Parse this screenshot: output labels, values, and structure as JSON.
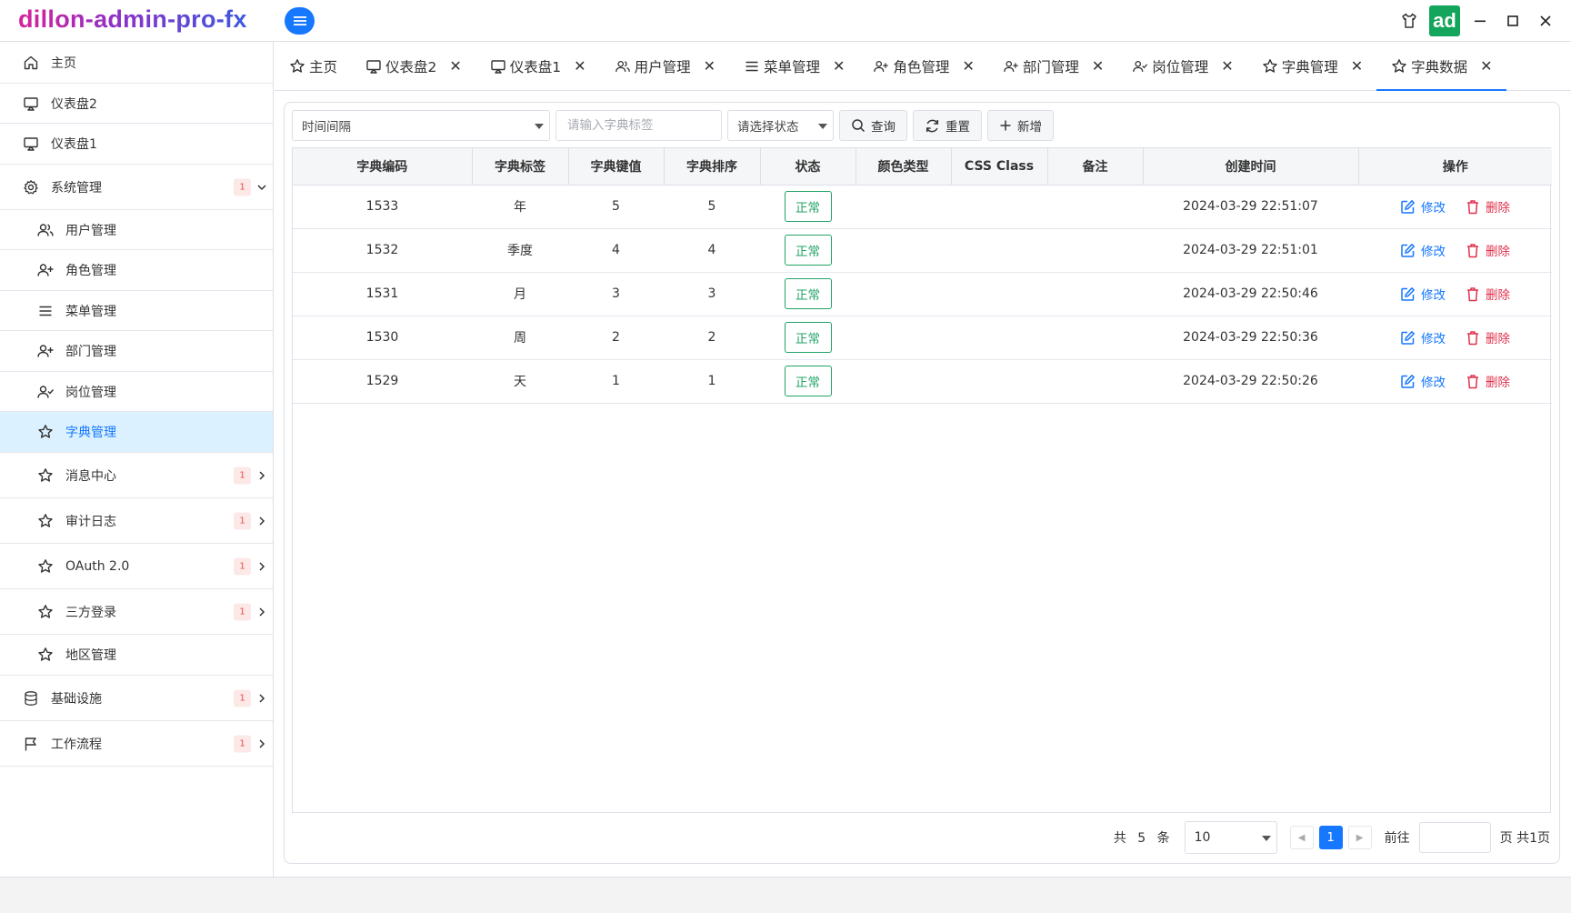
{
  "app": {
    "title": "dillon-admin-pro-fx",
    "avatar_text": "ad"
  },
  "window_controls": [
    "shirt-icon",
    "minimize-icon",
    "maximize-icon",
    "close-icon"
  ],
  "sidebar": {
    "items": [
      {
        "label": "主页",
        "icon": "home-icon"
      },
      {
        "label": "仪表盘2",
        "icon": "monitor-icon"
      },
      {
        "label": "仪表盘1",
        "icon": "monitor-icon"
      },
      {
        "label": "系统管理",
        "icon": "gear-icon",
        "badge": "1",
        "expanded": true
      },
      {
        "label": "用户管理",
        "icon": "users-icon"
      },
      {
        "label": "角色管理",
        "icon": "user-plus-icon"
      },
      {
        "label": "菜单管理",
        "icon": "list-icon"
      },
      {
        "label": "部门管理",
        "icon": "user-plus-icon"
      },
      {
        "label": "岗位管理",
        "icon": "user-check-icon"
      },
      {
        "label": "字典管理",
        "icon": "star-icon",
        "active": true
      },
      {
        "label": "消息中心",
        "icon": "star-icon",
        "badge": "1"
      },
      {
        "label": "审计日志",
        "icon": "star-icon",
        "badge": "1"
      },
      {
        "label": "OAuth 2.0",
        "icon": "star-icon",
        "badge": "1"
      },
      {
        "label": "三方登录",
        "icon": "star-icon",
        "badge": "1"
      },
      {
        "label": "地区管理",
        "icon": "star-icon"
      },
      {
        "label": "基础设施",
        "icon": "database-icon",
        "badge": "1"
      },
      {
        "label": "工作流程",
        "icon": "flag-icon",
        "badge": "1"
      }
    ]
  },
  "tabs": [
    {
      "label": "主页",
      "icon": "star-icon"
    },
    {
      "label": "仪表盘2",
      "icon": "monitor-icon"
    },
    {
      "label": "仪表盘1",
      "icon": "monitor-icon"
    },
    {
      "label": "用户管理",
      "icon": "users-icon"
    },
    {
      "label": "菜单管理",
      "icon": "list-icon"
    },
    {
      "label": "角色管理",
      "icon": "user-plus-icon"
    },
    {
      "label": "部门管理",
      "icon": "user-plus-icon"
    },
    {
      "label": "岗位管理",
      "icon": "user-check-icon"
    },
    {
      "label": "字典管理",
      "icon": "star-icon"
    },
    {
      "label": "字典数据",
      "icon": "star-icon",
      "active": true
    }
  ],
  "toolbar": {
    "dict_type_value": "时间间隔",
    "label_placeholder": "请输入字典标签",
    "status_placeholder": "请选择状态",
    "query_label": "查询",
    "reset_label": "重置",
    "add_label": "新增"
  },
  "table": {
    "columns": [
      "字典编码",
      "字典标签",
      "字典键值",
      "字典排序",
      "状态",
      "颜色类型",
      "CSS Class",
      "备注",
      "创建时间",
      "操作"
    ],
    "rows": [
      {
        "code": "1533",
        "label": "年",
        "value": "5",
        "sort": "5",
        "status": "正常",
        "color": "",
        "css": "",
        "remark": "",
        "created": "2024-03-29 22:51:07"
      },
      {
        "code": "1532",
        "label": "季度",
        "value": "4",
        "sort": "4",
        "status": "正常",
        "color": "",
        "css": "",
        "remark": "",
        "created": "2024-03-29 22:51:01"
      },
      {
        "code": "1531",
        "label": "月",
        "value": "3",
        "sort": "3",
        "status": "正常",
        "color": "",
        "css": "",
        "remark": "",
        "created": "2024-03-29 22:50:46"
      },
      {
        "code": "1530",
        "label": "周",
        "value": "2",
        "sort": "2",
        "status": "正常",
        "color": "",
        "css": "",
        "remark": "",
        "created": "2024-03-29 22:50:36"
      },
      {
        "code": "1529",
        "label": "天",
        "value": "1",
        "sort": "1",
        "status": "正常",
        "color": "",
        "css": "",
        "remark": "",
        "created": "2024-03-29 22:50:26"
      }
    ],
    "edit_label": "修改",
    "delete_label": "删除"
  },
  "pagination": {
    "total_prefix": "共",
    "total": "5",
    "total_suffix": "条",
    "page_size": "10",
    "current_page": "1",
    "goto_label": "前往",
    "page_suffix": "页 共1页"
  },
  "colors": {
    "accent": "#1677ff",
    "success": "#21a366",
    "danger": "#e0314b",
    "avatar": "#13a55b"
  }
}
